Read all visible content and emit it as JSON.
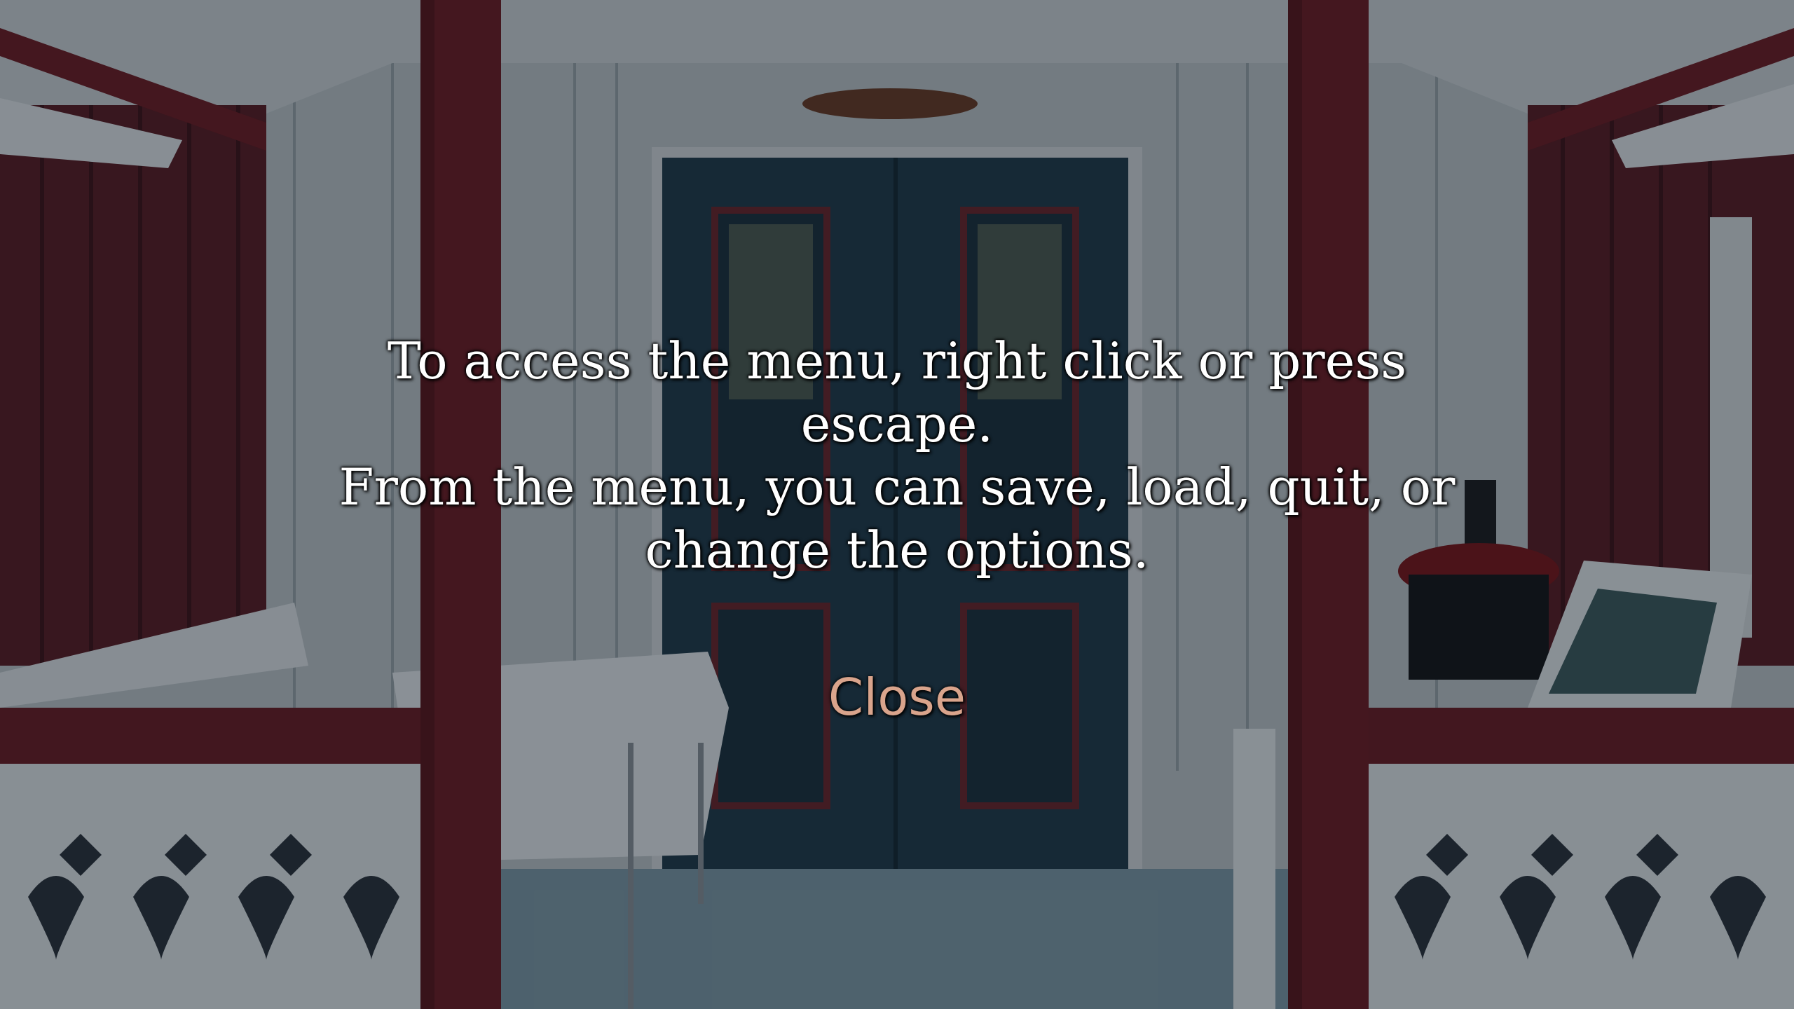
{
  "dialog": {
    "message_lines": [
      "To access the menu, right click or press escape.",
      "From the menu, you can save, load, quit, or",
      "change the options."
    ],
    "close_label": "Close"
  },
  "colors": {
    "message_text": "#ffffff",
    "close_text": "#d9a48c"
  }
}
